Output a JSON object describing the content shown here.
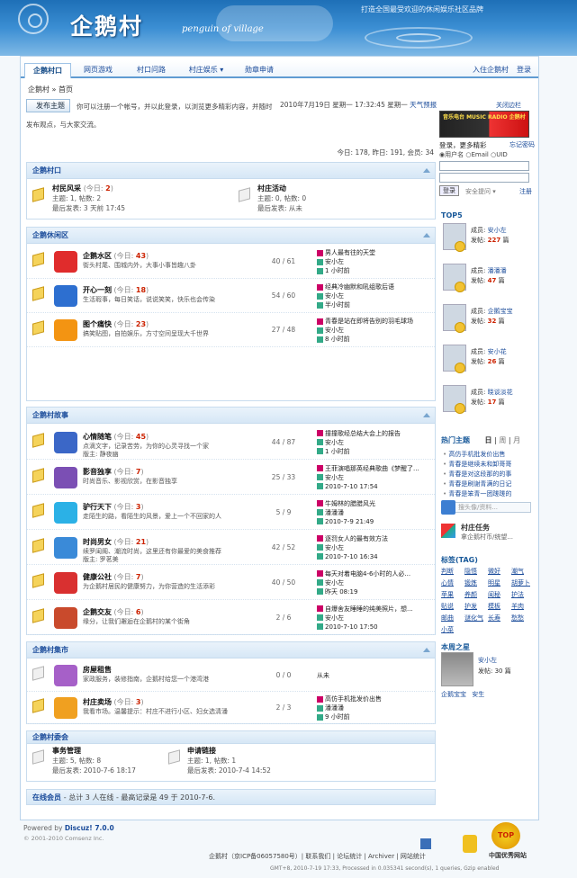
{
  "header": {
    "logo": "企鹅村",
    "slogan": "penguin of village",
    "tagline": "打造全国最受欢迎的休闲娱乐社区品牌"
  },
  "nav": {
    "tabs": [
      "企鹅村口",
      "网页游戏",
      "村口问路",
      "村庄娱乐 ▾",
      "勋章申请"
    ],
    "right": [
      "入住企鹅村",
      "登录"
    ]
  },
  "breadcrumb": "企鹅村 » 首页",
  "notice": {
    "button": "发布主题",
    "line1": "你可以注册一个帐号，并以此登录，以浏览更多精彩内容，并随时",
    "line2": "发布观点，与大家交流。",
    "datetime": "2010年7月19日  星期一  17:32:45 星期一",
    "weather": "天气预报",
    "close": "关闭边栏"
  },
  "stats": "今日: 178, 昨日: 191, 会员: 34",
  "sections": [
    {
      "title": "企鹅村口"
    },
    {
      "title": "企鹅休闲区"
    },
    {
      "title": "企鹅村故事"
    },
    {
      "title": "企鹅村集市"
    },
    {
      "title": "企鹅村委会"
    },
    {
      "title": "友情链接"
    }
  ],
  "village_gate": [
    {
      "name": "村民风采",
      "today": "2",
      "l1": "主题: 1, 帖数: 2",
      "l2": "最后发表: 3 天前 17:45"
    },
    {
      "name": "村庄活动",
      "today": "0",
      "l1": "主题: 0, 帖数: 0",
      "l2": "最后发表: 从未"
    }
  ],
  "leisure": [
    {
      "name": "企鹅水区",
      "today": "43",
      "desc": "街头村尾、围城内外，大事小事皆趣八卦",
      "count": "40 / 61",
      "post": "男人最有往的天堂",
      "user": "安小左",
      "time": "1 小时前",
      "color": "#e02c2c"
    },
    {
      "name": "开心一刻",
      "today": "18",
      "desc": "生活瑕事，每日笑话，说说笑笑，快乐也会传染",
      "count": "54 / 60",
      "post": "经典冷幽默和吼组歌后语",
      "user": "安小左",
      "time": "半小时前",
      "color": "#2d6fd0"
    },
    {
      "name": "图个痛快",
      "today": "23",
      "desc": "搞笑贴图，自拍娱乐，方寸空间呈现大千世界",
      "count": "27 / 48",
      "post": "青春是站在即将告别的羽毛球场",
      "user": "安小左",
      "time": "8 小时前",
      "color": "#f39412"
    }
  ],
  "stories": [
    {
      "name": "心情随笔",
      "today": "45",
      "desc": "点滴文字，记录苦劳，为你的心灵寻找一个家",
      "mod": "版主: 静夜幽",
      "count": "44 / 87",
      "post": "撞撞歌经总结大会上的报告",
      "user": "安小左",
      "time": "1 小时前",
      "color": "#3b67c7"
    },
    {
      "name": "影音独享",
      "today": "7",
      "desc": "时尚音乐、影视欣赏，在影音独享",
      "mod": "",
      "count": "25 / 33",
      "post": "王菲演唱那英经典歌曲《梦醒了...",
      "user": "安小左",
      "time": "2010-7-10 17:54",
      "color": "#7b4fb4"
    },
    {
      "name": "驴行天下",
      "today": "3",
      "desc": "走陌生的路，看陌生的风景，爱上一个不回家的人",
      "mod": "",
      "count": "5 / 9",
      "post": "牛姆林的腊腊风光",
      "user": "潘潘潘",
      "time": "2010-7-9 21:49",
      "color": "#2bb1e6"
    },
    {
      "name": "时尚男女",
      "today": "21",
      "desc": "续罗闺阁、潮流时尚，这里还有你最爱的美食推荐",
      "mod": "版主: 罗茗美",
      "count": "42 / 52",
      "post": "逐罚女人的最有效方法",
      "user": "安小左",
      "time": "2010-7-10 16:34",
      "color": "#3a8ad8"
    },
    {
      "name": "健康公社",
      "today": "7",
      "desc": "为企鹅村居民的健康努力，为你营造的生活添彩",
      "mod": "",
      "count": "40 / 50",
      "post": "每天对着电脑4-6小时的人必...",
      "user": "安小左",
      "time": "昨天 08:19",
      "color": "#d93030"
    },
    {
      "name": "企鹅交友",
      "today": "6",
      "desc": "缘分，让我们邂逅在企鹅村的某个街角",
      "mod": "",
      "count": "2 / 6",
      "post": "自爆舍友睡睡的纯美照片，想...",
      "user": "安小左",
      "time": "2010-7-10 17:50",
      "color": "#c94a2c"
    }
  ],
  "market": [
    {
      "name": "房屋租售",
      "today": "",
      "desc": "家政服务，装修指南，企鹅村给您一个港湾港",
      "count": "0 / 0",
      "post": "从未",
      "user": "",
      "time": "",
      "color": "#a660c8"
    },
    {
      "name": "村庄卖场",
      "today": "3",
      "desc": "我看市场。温馨提示：村庄不进行小区、妇女选清潘",
      "count": "2 / 3",
      "post": "高仿手机批发价出售",
      "user": "潘潘潘",
      "time": "9 小时前",
      "color": "#f0a020"
    }
  ],
  "committee": [
    {
      "name": "事务管理",
      "l1": "主题: 5, 帖数: 8",
      "l2": "最后发表: 2010-7-6 18:17"
    },
    {
      "name": "申请链接",
      "l1": "主题: 1, 帖数: 1",
      "l2": "最后发表: 2010-7-4 14:52"
    }
  ],
  "links": [
    "企鹅村",
    "",
    "女生卖场"
  ],
  "online": {
    "label": "在线会员",
    "text": "- 总计 3 人在线 - 最高记录是 49 于 2010-7-6."
  },
  "sidebar": {
    "banner": "音乐电台 MUSIC RADIO 企鹅村",
    "login_tip": "登录，更多精彩",
    "forgot": "忘记密码",
    "radio": [
      "用户名",
      "Email",
      "UID"
    ],
    "login_btn": "登录",
    "safe_q": "安全提问 ▾",
    "register": "注册",
    "top5_title": "TOP5",
    "top5": [
      {
        "name": "安小左",
        "posts": "227"
      },
      {
        "name": "潘潘潘",
        "posts": "47"
      },
      {
        "name": "企鹅宝宝",
        "posts": "32"
      },
      {
        "name": "安小花",
        "posts": "26"
      },
      {
        "name": "晓谈淡花",
        "posts": "17"
      }
    ],
    "member_label": "成员:",
    "posts_label": "发帖:",
    "posts_unit": "篇",
    "hot_title": "热门主题",
    "hot_tabs": [
      "日",
      "周",
      "月"
    ],
    "hot": [
      "高仿手机批发价出售",
      "青春是继续未和卸哥哥",
      "青春是对这段那的的事",
      "青春是刷谢青满的日记",
      "青春是笨青一团蹉蹉的"
    ],
    "search_ph": "搜头像/资料...",
    "task_title": "村庄任务",
    "task_desc": "拿企鹅村币/统望...",
    "tag_title": "标签(TAG)",
    "tags": [
      "判断",
      "隐悟",
      "微好",
      "潮气",
      "心情",
      "锻炼",
      "明星",
      "胡萝卜",
      "苹果",
      "养颜",
      "闺秘",
      "护法",
      "贴说",
      "护发",
      "模板",
      "羊肉",
      "邮曲",
      "谜化气",
      "长寿",
      "愁愁",
      "小菜"
    ],
    "star_title": "本周之星",
    "star_name": "安小左",
    "star_posts": "30",
    "star_foot": [
      "企鹅宝宝",
      "安生"
    ]
  },
  "footer": {
    "powered": "Powered by",
    "discuz": "Discuz! 7.0.0",
    "copy": "© 2001-2010 Comsenz Inc.",
    "links": "企鹅村（京ICP备06057580号）| 联系我们 | 论坛统计 | Archiver | 网站统计",
    "gmt": "GMT+8, 2010-7-19 17:33, Processed in 0.035341 second(s), 1 queries, Gzip enabled",
    "site": "中国优秀网站",
    "top": "TOP"
  }
}
